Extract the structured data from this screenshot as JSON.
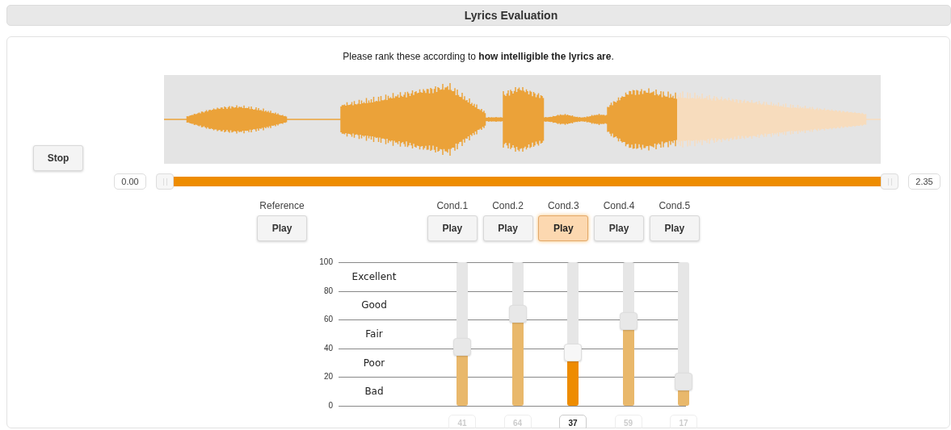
{
  "header": {
    "title": "Lyrics Evaluation"
  },
  "instruction": "Please rank these according to **how intelligible the lyrics are**.",
  "stop_button": "Stop",
  "waveform": {
    "level": 0.716
  },
  "loop": {
    "start": "0.00",
    "end": "2.35",
    "level": 1
  },
  "reference": {
    "label": "Reference",
    "button": "Play"
  },
  "conditions": [
    {
      "label": "Cond.1",
      "button": "Play",
      "selected": false,
      "level": 0.41,
      "value": "41"
    },
    {
      "label": "Cond.2",
      "button": "Play",
      "selected": false,
      "level": 0.64,
      "value": "64"
    },
    {
      "label": "Cond.3",
      "button": "Play",
      "selected": true,
      "level": 0.37,
      "value": "37"
    },
    {
      "label": "Cond.4",
      "button": "Play",
      "selected": false,
      "level": 0.59,
      "value": "59"
    },
    {
      "label": "Cond.5",
      "button": "Play",
      "selected": false,
      "level": 0.17,
      "value": "17"
    }
  ],
  "scale": {
    "ticks": [
      "100",
      "80",
      "60",
      "40",
      "20",
      "0"
    ],
    "categories": [
      "Excellent",
      "Good",
      "Fair",
      "Poor",
      "Bad"
    ]
  }
}
